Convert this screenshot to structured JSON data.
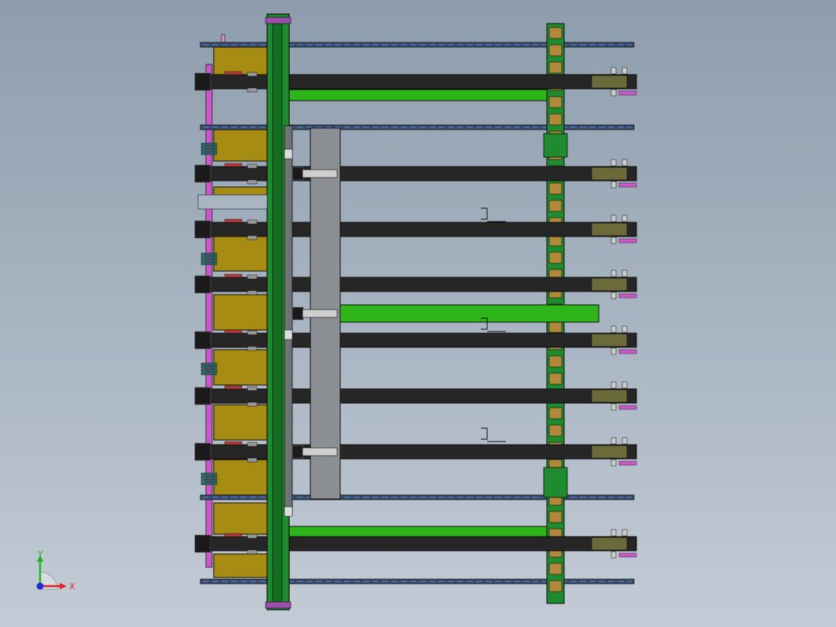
{
  "viewport": {
    "background_top": "#8e9dad",
    "background_bottom": "#c3ccd6"
  },
  "model": {
    "colors": {
      "beam": "#262626",
      "frame_green": "#1e8c2e",
      "bright_green": "#2db51a",
      "yellow_block": "#a68c12",
      "gray_column": "#8c8f93",
      "magenta": "#c85ac8",
      "edge": "#0d0d0d",
      "rail_blue": "#4a7dc8"
    },
    "beam_count": 8,
    "rail_count": 4,
    "parts": [
      "top-rail",
      "left-frame",
      "right-frame",
      "gray-column",
      "yellow-blocks",
      "magenta-rod"
    ]
  },
  "triad": {
    "y_label": "Y",
    "x_label": "X",
    "y_color": "#1fb51f",
    "x_color": "#e02020",
    "z_color": "#2030d0"
  }
}
